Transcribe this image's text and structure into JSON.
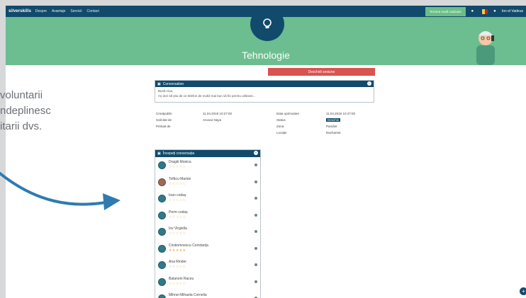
{
  "left_text": [
    "voluntarii",
    "ndeplinesc",
    "itarii dvs."
  ],
  "navbar": {
    "logo": "silverskills",
    "links": [
      "Despre",
      "Avantaje",
      "Servicii",
      "Contact"
    ],
    "cta": "Tecnica nouă cadoului",
    "user": "Ion el Vadeus"
  },
  "hero": {
    "title": "Tehnologie"
  },
  "close_button": "Deschidi sesiune",
  "details": {
    "panel_title": "Conversation",
    "message_line1": "Bună ziua,",
    "message_line2": "Aș dori să știu de ce telefon de mobil mai bun să fie pentru utilizare...",
    "labels": {
      "created": "Creatpublic",
      "sponsor": "Solicitat de",
      "taken": "Preluat de",
      "expired": "Data oprimulare",
      "status": "Status",
      "area": "Zona",
      "location": "Locație"
    },
    "values": {
      "created": "11.04.2018 10:27:00",
      "sponsor": "Anovar Naya",
      "expired": "11.04.2018 10:47:00",
      "status": "Deschis",
      "area": "Pamânt",
      "location": "Dacharest"
    }
  },
  "conversations": {
    "title": "Începeți conversația",
    "items": [
      {
        "name": "Dragiii Monica"
      },
      {
        "name": "Tofăcu Marian"
      },
      {
        "name": "Ioan codaș"
      },
      {
        "name": "Perm codaș"
      },
      {
        "name": "Iov Virgiella"
      },
      {
        "name": "Cristiomnescu Constanța"
      },
      {
        "name": "Ana Rinder"
      },
      {
        "name": "Balanoni Raceu"
      },
      {
        "name": "Mihnei Mihaela Cornelia"
      }
    ]
  },
  "colors": {
    "navy": "#114a6b",
    "green": "#6cbd8f",
    "red": "#d9534f",
    "arrow": "#2e7bb0"
  },
  "icons": {
    "hero": "lightbulb-icon",
    "help": "plus-icon"
  }
}
